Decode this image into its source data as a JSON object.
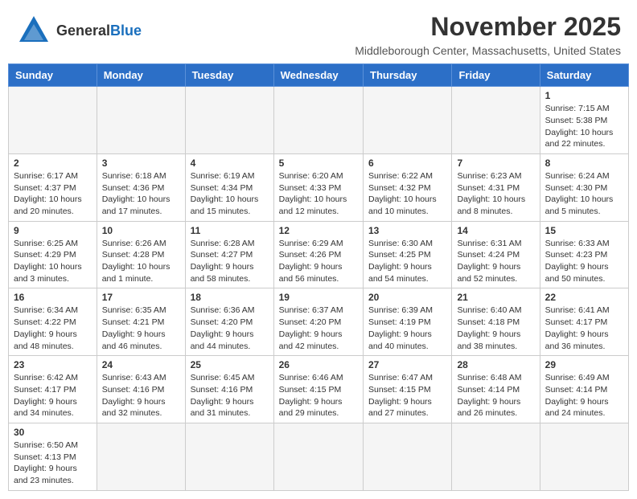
{
  "header": {
    "logo_general": "General",
    "logo_blue": "Blue",
    "month_title": "November 2025",
    "subtitle": "Middleborough Center, Massachusetts, United States"
  },
  "days_of_week": [
    "Sunday",
    "Monday",
    "Tuesday",
    "Wednesday",
    "Thursday",
    "Friday",
    "Saturday"
  ],
  "weeks": [
    [
      {
        "day": "",
        "info": ""
      },
      {
        "day": "",
        "info": ""
      },
      {
        "day": "",
        "info": ""
      },
      {
        "day": "",
        "info": ""
      },
      {
        "day": "",
        "info": ""
      },
      {
        "day": "",
        "info": ""
      },
      {
        "day": "1",
        "info": "Sunrise: 7:15 AM\nSunset: 5:38 PM\nDaylight: 10 hours and 22 minutes."
      }
    ],
    [
      {
        "day": "2",
        "info": "Sunrise: 6:17 AM\nSunset: 4:37 PM\nDaylight: 10 hours and 20 minutes."
      },
      {
        "day": "3",
        "info": "Sunrise: 6:18 AM\nSunset: 4:36 PM\nDaylight: 10 hours and 17 minutes."
      },
      {
        "day": "4",
        "info": "Sunrise: 6:19 AM\nSunset: 4:34 PM\nDaylight: 10 hours and 15 minutes."
      },
      {
        "day": "5",
        "info": "Sunrise: 6:20 AM\nSunset: 4:33 PM\nDaylight: 10 hours and 12 minutes."
      },
      {
        "day": "6",
        "info": "Sunrise: 6:22 AM\nSunset: 4:32 PM\nDaylight: 10 hours and 10 minutes."
      },
      {
        "day": "7",
        "info": "Sunrise: 6:23 AM\nSunset: 4:31 PM\nDaylight: 10 hours and 8 minutes."
      },
      {
        "day": "8",
        "info": "Sunrise: 6:24 AM\nSunset: 4:30 PM\nDaylight: 10 hours and 5 minutes."
      }
    ],
    [
      {
        "day": "9",
        "info": "Sunrise: 6:25 AM\nSunset: 4:29 PM\nDaylight: 10 hours and 3 minutes."
      },
      {
        "day": "10",
        "info": "Sunrise: 6:26 AM\nSunset: 4:28 PM\nDaylight: 10 hours and 1 minute."
      },
      {
        "day": "11",
        "info": "Sunrise: 6:28 AM\nSunset: 4:27 PM\nDaylight: 9 hours and 58 minutes."
      },
      {
        "day": "12",
        "info": "Sunrise: 6:29 AM\nSunset: 4:26 PM\nDaylight: 9 hours and 56 minutes."
      },
      {
        "day": "13",
        "info": "Sunrise: 6:30 AM\nSunset: 4:25 PM\nDaylight: 9 hours and 54 minutes."
      },
      {
        "day": "14",
        "info": "Sunrise: 6:31 AM\nSunset: 4:24 PM\nDaylight: 9 hours and 52 minutes."
      },
      {
        "day": "15",
        "info": "Sunrise: 6:33 AM\nSunset: 4:23 PM\nDaylight: 9 hours and 50 minutes."
      }
    ],
    [
      {
        "day": "16",
        "info": "Sunrise: 6:34 AM\nSunset: 4:22 PM\nDaylight: 9 hours and 48 minutes."
      },
      {
        "day": "17",
        "info": "Sunrise: 6:35 AM\nSunset: 4:21 PM\nDaylight: 9 hours and 46 minutes."
      },
      {
        "day": "18",
        "info": "Sunrise: 6:36 AM\nSunset: 4:20 PM\nDaylight: 9 hours and 44 minutes."
      },
      {
        "day": "19",
        "info": "Sunrise: 6:37 AM\nSunset: 4:20 PM\nDaylight: 9 hours and 42 minutes."
      },
      {
        "day": "20",
        "info": "Sunrise: 6:39 AM\nSunset: 4:19 PM\nDaylight: 9 hours and 40 minutes."
      },
      {
        "day": "21",
        "info": "Sunrise: 6:40 AM\nSunset: 4:18 PM\nDaylight: 9 hours and 38 minutes."
      },
      {
        "day": "22",
        "info": "Sunrise: 6:41 AM\nSunset: 4:17 PM\nDaylight: 9 hours and 36 minutes."
      }
    ],
    [
      {
        "day": "23",
        "info": "Sunrise: 6:42 AM\nSunset: 4:17 PM\nDaylight: 9 hours and 34 minutes."
      },
      {
        "day": "24",
        "info": "Sunrise: 6:43 AM\nSunset: 4:16 PM\nDaylight: 9 hours and 32 minutes."
      },
      {
        "day": "25",
        "info": "Sunrise: 6:45 AM\nSunset: 4:16 PM\nDaylight: 9 hours and 31 minutes."
      },
      {
        "day": "26",
        "info": "Sunrise: 6:46 AM\nSunset: 4:15 PM\nDaylight: 9 hours and 29 minutes."
      },
      {
        "day": "27",
        "info": "Sunrise: 6:47 AM\nSunset: 4:15 PM\nDaylight: 9 hours and 27 minutes."
      },
      {
        "day": "28",
        "info": "Sunrise: 6:48 AM\nSunset: 4:14 PM\nDaylight: 9 hours and 26 minutes."
      },
      {
        "day": "29",
        "info": "Sunrise: 6:49 AM\nSunset: 4:14 PM\nDaylight: 9 hours and 24 minutes."
      }
    ],
    [
      {
        "day": "30",
        "info": "Sunrise: 6:50 AM\nSunset: 4:13 PM\nDaylight: 9 hours and 23 minutes."
      },
      {
        "day": "",
        "info": ""
      },
      {
        "day": "",
        "info": ""
      },
      {
        "day": "",
        "info": ""
      },
      {
        "day": "",
        "info": ""
      },
      {
        "day": "",
        "info": ""
      },
      {
        "day": "",
        "info": ""
      }
    ]
  ]
}
